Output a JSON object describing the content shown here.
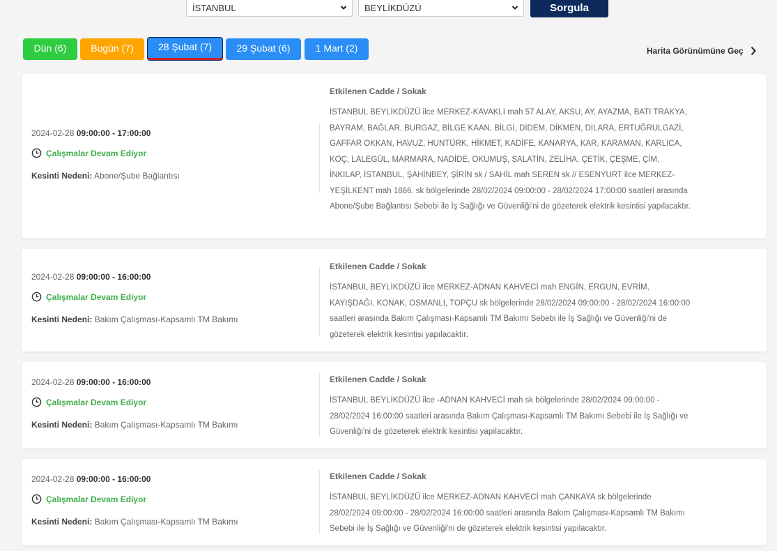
{
  "filters": {
    "city": "İSTANBUL",
    "district": "BEYLİKDÜZÜ",
    "query_label": "Sorgula"
  },
  "tabs": [
    {
      "label": "Dün (6)",
      "color": "#2ecc40"
    },
    {
      "label": "Bugün (7)",
      "color": "#fea500"
    },
    {
      "label": "28 Şubat (7)",
      "color": "#2b8df6",
      "active": true
    },
    {
      "label": "29 Şubat (6)",
      "color": "#2b8df6"
    },
    {
      "label": "1 Mart (2)",
      "color": "#2b8df6"
    }
  ],
  "map_link": "Harita Görünümüne Geç",
  "labels": {
    "status": "Çalışmalar Devam Ediyor",
    "reason_label": "Kesinti Nedeni:",
    "affected_head": "Etkilenen Cadde / Sokak"
  },
  "outages": [
    {
      "date": "2024-02-28",
      "time": "09:00:00 - 17:00:00",
      "reason": "Abone/Şube Bağlantısı",
      "description": "İSTANBUL BEYLİKDÜZÜ ilce MERKEZ-KAVAKLI mah 57 ALAY, AKSU, AY, AYAZMA, BATI TRAKYA, BAYRAM, BAĞLAR, BURGAZ, BİLGE KAAN, BİLGİ, DİDEM, DİKMEN, DİLARA, ERTUĞRULGAZİ, GAFFAR OKKAN, HAVUZ, HUNTÜRK, HİKMET, KADİFE, KANARYA, KAR, KARAMAN, KARLICA, KOÇ, LALEGÜL, MARMARA, NADİDE, OKUMUŞ, SALATİN, ZELİHA, ÇETİK, ÇEŞME, ÇİM, İNKILAP, İSTANBUL, ŞAHİNBEY, ŞİRİN sk / SAHİL mah SEREN sk // ESENYURT ilce MERKEZ-YEŞİLKENT mah 1866. sk bölgelerinde 28/02/2024 09:00:00 - 28/02/2024 17:00:00 saatleri arasında Abone/Şube Bağlantısı Sebebi ile İş Sağlığı ve Güvenliği'ni de gözeterek elektrik kesintisi yapılacaktır."
    },
    {
      "date": "2024-02-28",
      "time": "09:00:00 - 16:00:00",
      "reason": "Bakım Çalışması-Kapsamlı TM Bakımı",
      "description": "İSTANBUL BEYLİKDÜZÜ ilce MERKEZ-ADNAN KAHVECİ mah ENGİN, ERGUN, EVRİM, KAYIŞDAĞI, KONAK, OSMANLI, TOPÇU sk bölgelerinde 28/02/2024 09:00:00 - 28/02/2024 16:00:00 saatleri arasında Bakım Çalışması-Kapsamlı TM Bakımı Sebebi ile İş Sağlığı ve Güvenliği'ni de gözeterek elektrik kesintisi yapılacaktır."
    },
    {
      "date": "2024-02-28",
      "time": "09:00:00 - 16:00:00",
      "reason": "Bakım Çalışması-Kapsamlı TM Bakımı",
      "description": "İSTANBUL BEYLİKDÜZÜ ilce -ADNAN KAHVECİ mah sk bölgelerinde 28/02/2024 09:00:00 - 28/02/2024 16:00:00 saatleri arasında Bakım Çalışması-Kapsamlı TM Bakımı Sebebi ile İş Sağlığı ve Güvenliği'ni de gözeterek elektrik kesintisi yapılacaktır."
    },
    {
      "date": "2024-02-28",
      "time": "09:00:00 - 16:00:00",
      "reason": "Bakım Çalışması-Kapsamlı TM Bakımı",
      "description": "İSTANBUL BEYLİKDÜZÜ ilce MERKEZ-ADNAN KAHVECİ mah ÇANKAYA sk bölgelerinde 28/02/2024 09:00:00 - 28/02/2024 16:00:00 saatleri arasında Bakım Çalışması-Kapsamlı TM Bakımı Sebebi ile İş Sağlığı ve Güvenliği'ni de gözeterek elektrik kesintisi yapılacaktır."
    }
  ]
}
